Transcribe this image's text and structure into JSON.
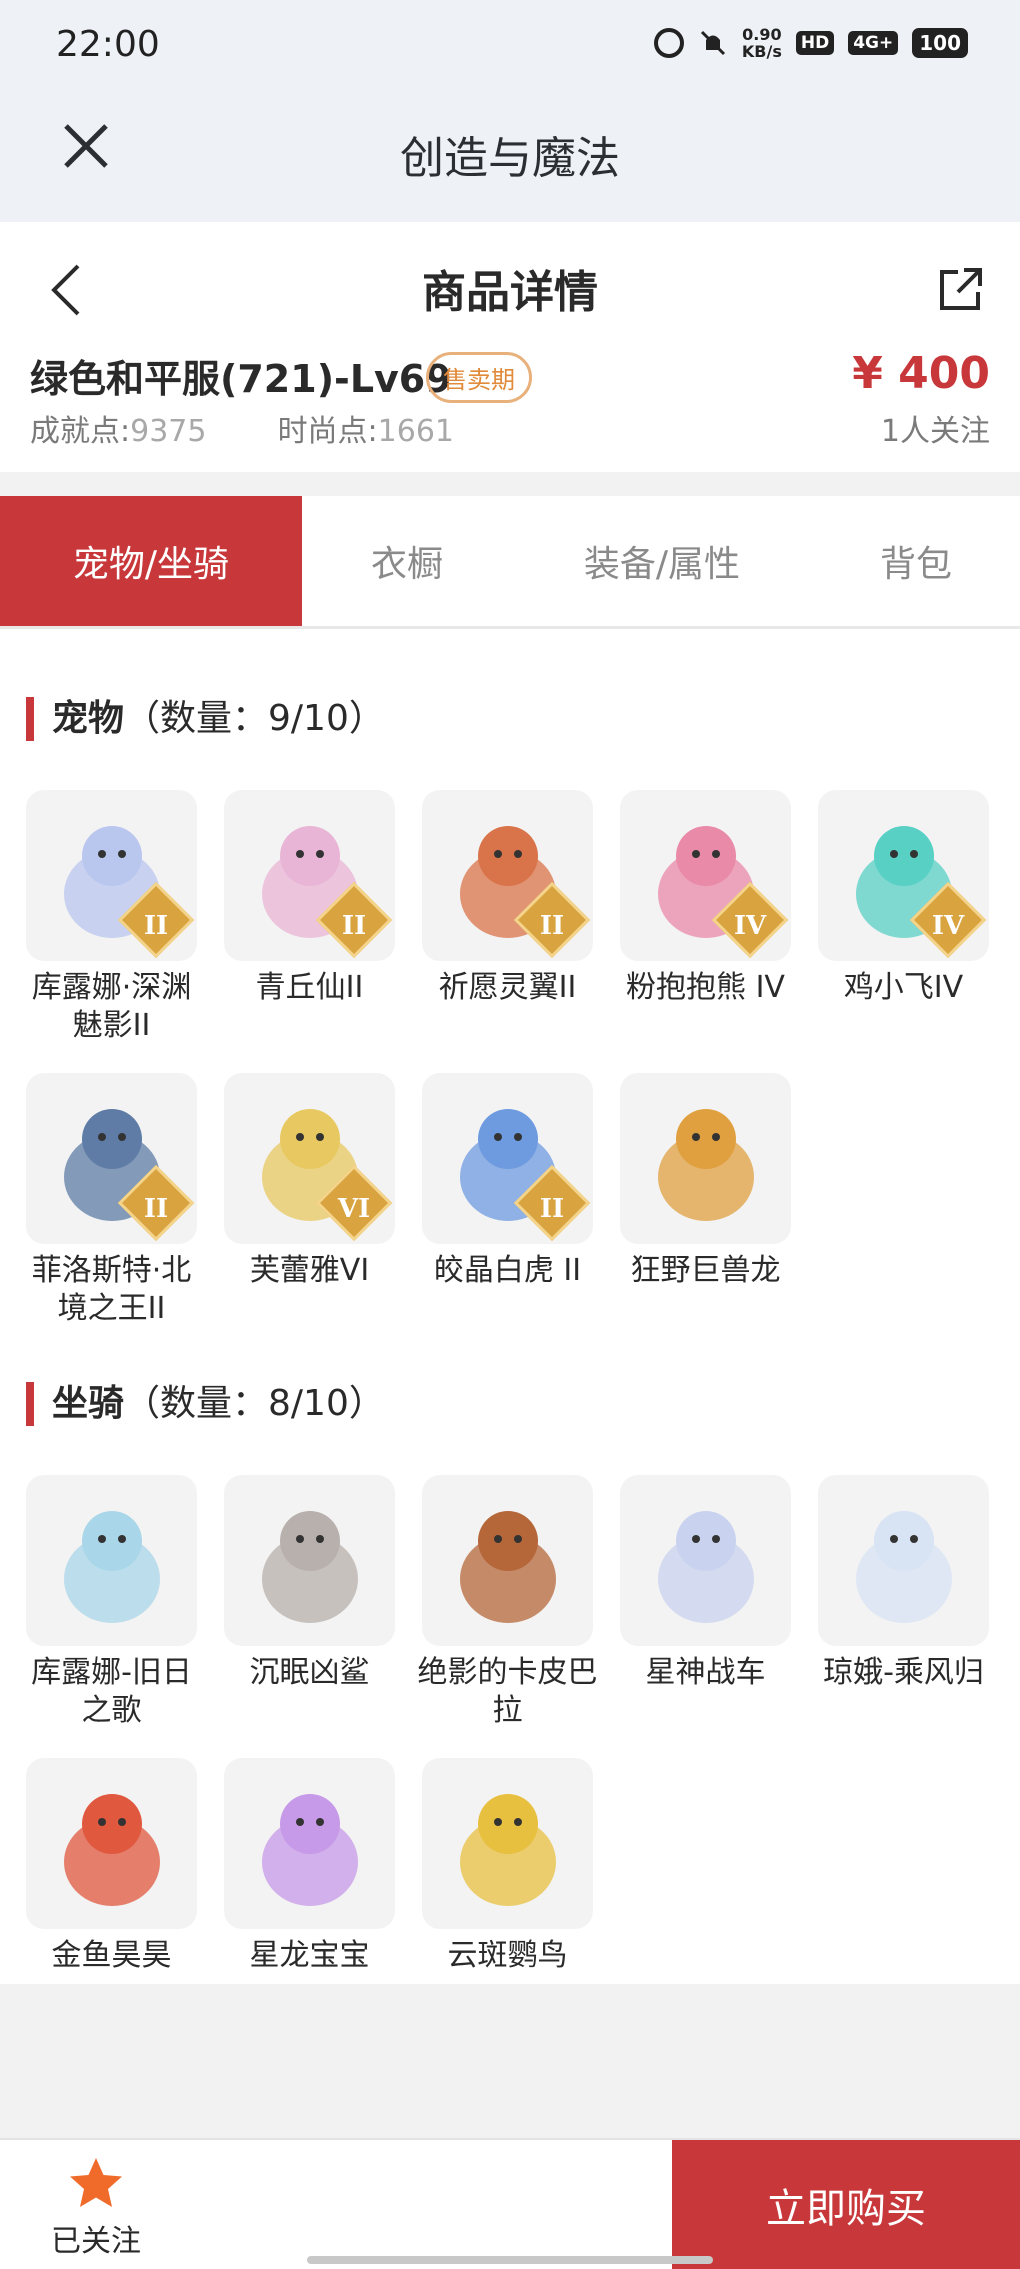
{
  "status_bar": {
    "time": "22:00",
    "speed_value": "0.90",
    "speed_unit": "KB/s",
    "hd": "HD",
    "network": "4G+",
    "battery": "100"
  },
  "app_bar": {
    "title": "创造与魔法",
    "close_icon": "close-icon"
  },
  "detail": {
    "title": "商品详情",
    "item_name": "绿色和平服(721)-Lv69",
    "sale_badge": "售卖期",
    "price": "¥ 400",
    "followers": "1人关注",
    "achievement_label": "成就点:",
    "achievement_value": "9375",
    "fashion_label": "时尚点:",
    "fashion_value": "1661"
  },
  "tabs": [
    {
      "label": "宠物/坐骑",
      "active": true
    },
    {
      "label": "衣橱",
      "active": false
    },
    {
      "label": "装备/属性",
      "active": false
    },
    {
      "label": "背包",
      "active": false
    }
  ],
  "pets_section": {
    "title": "宠物",
    "count": "（数量：9/10）",
    "items": [
      {
        "name": "库露娜·深渊魅影II",
        "tier": "II",
        "icon": "deep-sea-fairy",
        "color": "#b9c7ef"
      },
      {
        "name": "青丘仙II",
        "tier": "II",
        "icon": "fox-fairy",
        "color": "#e9b5d6"
      },
      {
        "name": "祈愿灵翼II",
        "tier": "II",
        "icon": "eagle",
        "color": "#d9744a"
      },
      {
        "name": "粉抱抱熊 IV",
        "tier": "IV",
        "icon": "pink-bear",
        "color": "#e98aa9"
      },
      {
        "name": "鸡小飞IV",
        "tier": "IV",
        "icon": "chick",
        "color": "#58d0c4"
      },
      {
        "name": "菲洛斯特·北境之王II",
        "tier": "II",
        "icon": "dark-knight",
        "color": "#5f7ca6"
      },
      {
        "name": "芙蕾雅VI",
        "tier": "VI",
        "icon": "valkyrie",
        "color": "#e8c860"
      },
      {
        "name": "皎晶白虎 II",
        "tier": "II",
        "icon": "white-tiger",
        "color": "#6e9be0"
      },
      {
        "name": "狂野巨兽龙",
        "tier": "",
        "icon": "beast-dragon",
        "color": "#e0a040"
      }
    ]
  },
  "mounts_section": {
    "title": "坐骑",
    "count": "（数量：8/10）",
    "items": [
      {
        "name": "库露娜-旧日之歌",
        "tier": "",
        "icon": "sheep-girl",
        "color": "#a9d6e8"
      },
      {
        "name": "沉眠凶鲨",
        "tier": "",
        "icon": "shark",
        "color": "#b8b0ac"
      },
      {
        "name": "绝影的卡皮巴拉",
        "tier": "",
        "icon": "capybara",
        "color": "#b5673a"
      },
      {
        "name": "星神战车",
        "tier": "",
        "icon": "star-steed",
        "color": "#c9d3ef"
      },
      {
        "name": "琼娥-乘风归",
        "tier": "",
        "icon": "moon-maiden",
        "color": "#d8e3f4"
      },
      {
        "name": "金鱼昊昊",
        "tier": "",
        "icon": "goldfish",
        "color": "#e0583e"
      },
      {
        "name": "星龙宝宝",
        "tier": "",
        "icon": "baby-dragon",
        "color": "#c69ae8"
      },
      {
        "name": "云斑鹦鸟",
        "tier": "",
        "icon": "parrot",
        "color": "#e8c040"
      }
    ]
  },
  "bottom_bar": {
    "follow_label": "已关注",
    "buy_label": "立即购买",
    "accent": "#c8373a",
    "star_color": "#f06a2a"
  }
}
